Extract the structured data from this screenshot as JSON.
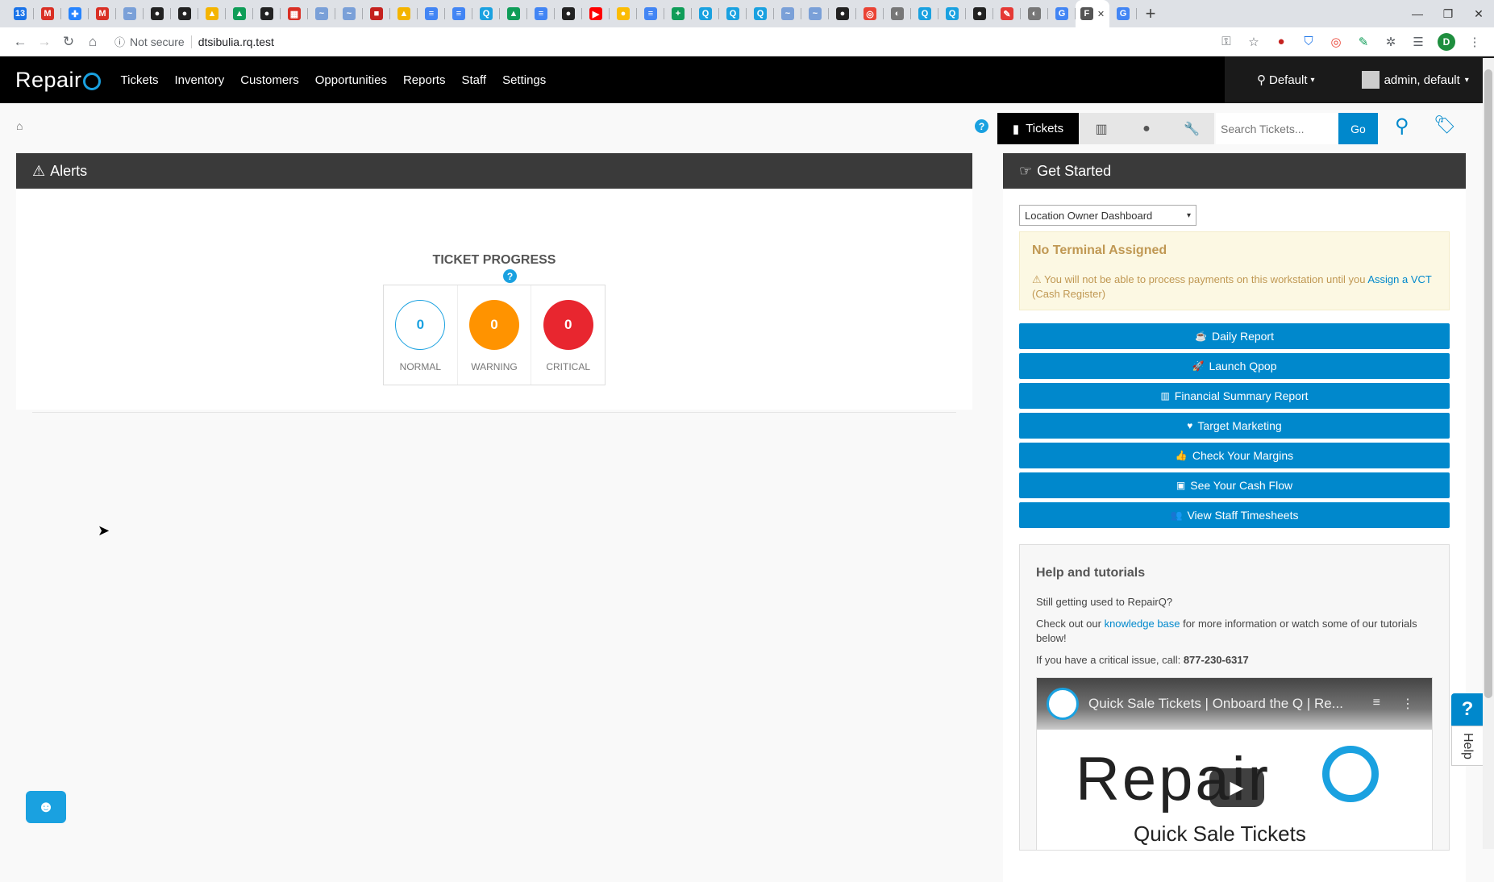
{
  "browser": {
    "tabs": [
      {
        "icon": "calendar-icon",
        "color": "#1a73e8",
        "glyph": "13"
      },
      {
        "icon": "gmail-icon",
        "color": "#d93025",
        "glyph": "M"
      },
      {
        "icon": "jira-icon",
        "color": "#2684ff",
        "glyph": "✚"
      },
      {
        "icon": "gmail-icon",
        "color": "#d93025",
        "glyph": "M"
      },
      {
        "icon": "wave-icon",
        "color": "#7aa0d8",
        "glyph": "~"
      },
      {
        "icon": "github-icon",
        "color": "#222222",
        "glyph": "●"
      },
      {
        "icon": "github-icon",
        "color": "#222222",
        "glyph": "●"
      },
      {
        "icon": "drive-icon",
        "color": "#f4b400",
        "glyph": "▲"
      },
      {
        "icon": "drive-icon",
        "color": "#0f9d58",
        "glyph": "▲"
      },
      {
        "icon": "github-icon",
        "color": "#222222",
        "glyph": "●"
      },
      {
        "icon": "calendar-red-icon",
        "color": "#d93025",
        "glyph": "▦"
      },
      {
        "icon": "wave-icon",
        "color": "#7aa0d8",
        "glyph": "~"
      },
      {
        "icon": "wave-icon",
        "color": "#7aa0d8",
        "glyph": "~"
      },
      {
        "icon": "office-icon",
        "color": "#c5221f",
        "glyph": "■"
      },
      {
        "icon": "drive-icon",
        "color": "#f4b400",
        "glyph": "▲"
      },
      {
        "icon": "docs-icon",
        "color": "#4285f4",
        "glyph": "≡"
      },
      {
        "icon": "docs-icon",
        "color": "#4285f4",
        "glyph": "≡"
      },
      {
        "icon": "q-icon",
        "color": "#1aa1e0",
        "glyph": "Q"
      },
      {
        "icon": "drive-icon",
        "color": "#0f9d58",
        "glyph": "▲"
      },
      {
        "icon": "docs-icon",
        "color": "#4285f4",
        "glyph": "≡"
      },
      {
        "icon": "github-icon",
        "color": "#222222",
        "glyph": "●"
      },
      {
        "icon": "youtube-icon",
        "color": "#ff0000",
        "glyph": "▶"
      },
      {
        "icon": "keep-icon",
        "color": "#fbbc04",
        "glyph": "●"
      },
      {
        "icon": "docs-icon",
        "color": "#4285f4",
        "glyph": "≡"
      },
      {
        "icon": "sheets-icon",
        "color": "#0f9d58",
        "glyph": "+"
      },
      {
        "icon": "q-icon",
        "color": "#1aa1e0",
        "glyph": "Q"
      },
      {
        "icon": "q-icon",
        "color": "#1aa1e0",
        "glyph": "Q"
      },
      {
        "icon": "q-icon",
        "color": "#1aa1e0",
        "glyph": "Q"
      },
      {
        "icon": "wave-icon",
        "color": "#7aa0d8",
        "glyph": "~"
      },
      {
        "icon": "wave-icon",
        "color": "#7aa0d8",
        "glyph": "~"
      },
      {
        "icon": "github-icon",
        "color": "#222222",
        "glyph": "●"
      },
      {
        "icon": "target-icon",
        "color": "#ea4335",
        "glyph": "◎"
      },
      {
        "icon": "globe-icon",
        "color": "#777777",
        "glyph": "◐"
      },
      {
        "icon": "q-icon",
        "color": "#1aa1e0",
        "glyph": "Q"
      },
      {
        "icon": "q-icon",
        "color": "#1aa1e0",
        "glyph": "Q"
      },
      {
        "icon": "github-icon",
        "color": "#222222",
        "glyph": "●"
      },
      {
        "icon": "feather-icon",
        "color": "#e53935",
        "glyph": "✎"
      },
      {
        "icon": "globe-icon",
        "color": "#777777",
        "glyph": "◐"
      },
      {
        "icon": "google-icon",
        "color": "#4285f4",
        "glyph": "G"
      },
      {
        "icon": "page-icon",
        "color": "#555555",
        "glyph": "F",
        "active": true
      },
      {
        "icon": "google-icon",
        "color": "#4285f4",
        "glyph": "G"
      }
    ],
    "address": {
      "security": "Not secure",
      "url": "dtsibulia.rq.test"
    },
    "profile_initial": "D"
  },
  "app": {
    "brand": "RepairQ",
    "brand_prefix": "Repair",
    "nav": [
      "Tickets",
      "Inventory",
      "Customers",
      "Opportunities",
      "Reports",
      "Staff",
      "Settings"
    ],
    "location": "Default",
    "user": "admin, default"
  },
  "toolbar": {
    "active_tab": "Tickets",
    "search_placeholder": "Search Tickets...",
    "go_label": "Go"
  },
  "alerts": {
    "title": "Alerts",
    "progress_title": "TICKET PROGRESS",
    "counters": [
      {
        "label": "NORMAL",
        "value": "0"
      },
      {
        "label": "WARNING",
        "value": "0"
      },
      {
        "label": "CRITICAL",
        "value": "0"
      }
    ]
  },
  "get_started": {
    "title": "Get Started",
    "dashboard_select": "Location Owner Dashboard",
    "warning": {
      "title": "No Terminal Assigned",
      "text": "You will not be able to process payments on this workstation until you",
      "link": "Assign a VCT",
      "suffix": "(Cash Register)"
    },
    "actions": [
      {
        "label": "Daily Report",
        "icon": "coffee-icon",
        "glyph": "☕"
      },
      {
        "label": "Launch Qpop",
        "icon": "rocket-icon",
        "glyph": "🚀"
      },
      {
        "label": "Financial Summary Report",
        "icon": "bar-chart-icon",
        "glyph": "▥"
      },
      {
        "label": "Target Marketing",
        "icon": "heart-icon",
        "glyph": "♥"
      },
      {
        "label": "Check Your Margins",
        "icon": "thumbs-up-icon",
        "glyph": "👍"
      },
      {
        "label": "See Your Cash Flow",
        "icon": "money-icon",
        "glyph": "▣"
      },
      {
        "label": "View Staff Timesheets",
        "icon": "users-icon",
        "glyph": "👥"
      }
    ],
    "help": {
      "title": "Help and tutorials",
      "line1": "Still getting used to RepairQ?",
      "line2_prefix": "Check out our",
      "line2_link": "knowledge base",
      "line2_suffix": "for more information or watch some of our tutorials below!",
      "line3_prefix": "If you have a critical issue, call:",
      "phone": "877-230-6317",
      "video_title": "Quick Sale Tickets | Onboard the Q | Re...",
      "video_brand": "Repair",
      "video_subtitle": "Quick Sale Tickets"
    }
  },
  "help_tab": {
    "label": "Help",
    "q": "?"
  }
}
